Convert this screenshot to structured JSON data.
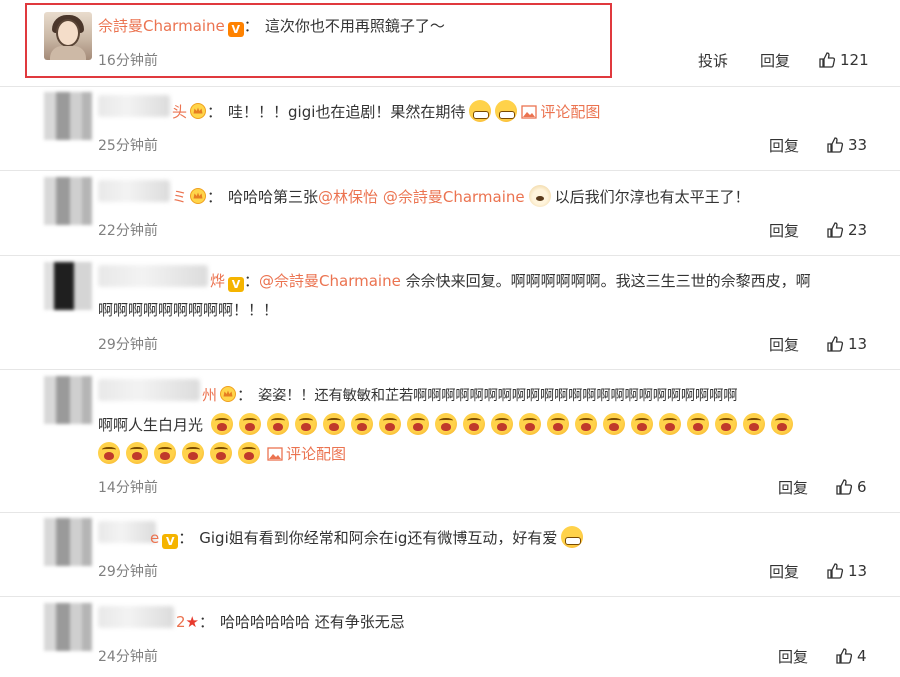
{
  "comments": [
    {
      "name": "佘詩曼Charmaine",
      "text": "這次你也不用再照鏡子了～",
      "time": "16分钟前",
      "report_label": "投诉",
      "reply_label": "回复",
      "likes": "121"
    },
    {
      "name_partial": "头",
      "text": "哇！！！gigi也在追剧！果然在期待",
      "link": "评论配图",
      "time": "25分钟前",
      "reply_label": "回复",
      "likes": "33"
    },
    {
      "name_partial": "ミ",
      "text_before": "哈哈哈第三张",
      "mention1": "@林保怡",
      "mention2": "@佘詩曼Charmaine",
      "text_after": "以后我们尔淳也有太平王了！",
      "time": "22分钟前",
      "reply_label": "回复",
      "likes": "23"
    },
    {
      "name_partial": "烨",
      "mention": "@佘詩曼Charmaine",
      "text_line1": "佘佘快来回复。啊啊啊啊啊啊。我这三生三世的佘黎西皮，啊",
      "text_line2": "啊啊啊啊啊啊啊啊啊！！！",
      "time": "29分钟前",
      "reply_label": "回复",
      "likes": "13"
    },
    {
      "name_partial": "州",
      "text_line1": "姿姿！！还有敏敏和芷若啊啊啊啊啊啊啊啊啊啊啊啊啊啊啊啊啊啊啊啊啊啊啊",
      "text_line2": "啊啊人生白月光",
      "link": "评论配图",
      "time": "14分钟前",
      "reply_label": "回复",
      "likes": "6"
    },
    {
      "name_partial": "e",
      "text": "Gigi姐有看到你经常和阿佘在ig还有微博互动，好有爱",
      "time": "29分钟前",
      "reply_label": "回复",
      "likes": "13"
    },
    {
      "name_partial": "2",
      "text": "哈哈哈哈哈哈 还有争张无忌",
      "time": "24分钟前",
      "reply_label": "回复",
      "likes": "4"
    }
  ],
  "colors": {
    "name": "#eb7350",
    "highlight_border": "#e0393e",
    "time": "#808080"
  },
  "icons": {
    "like": "thumbs-up-icon",
    "verified": "verified-v-icon",
    "crown": "crown-icon",
    "star": "star-icon"
  }
}
